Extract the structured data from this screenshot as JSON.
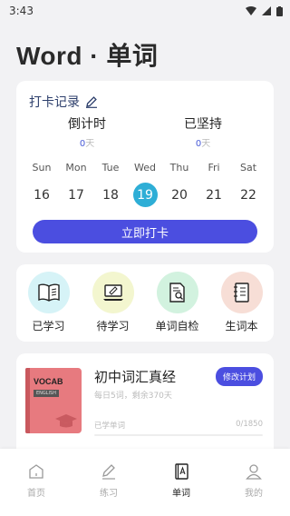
{
  "status": {
    "time": "3:43"
  },
  "title": "Word · 单词",
  "checkin": {
    "header": "打卡记录",
    "countdown_label": "倒计时",
    "countdown_value": "0",
    "countdown_unit": "天",
    "persist_label": "已坚持",
    "persist_value": "0",
    "persist_unit": "天",
    "week": [
      {
        "name": "Sun",
        "num": "16",
        "active": false
      },
      {
        "name": "Mon",
        "num": "17",
        "active": false
      },
      {
        "name": "Tue",
        "num": "18",
        "active": false
      },
      {
        "name": "Wed",
        "num": "19",
        "active": true
      },
      {
        "name": "Thu",
        "num": "20",
        "active": false
      },
      {
        "name": "Fri",
        "num": "21",
        "active": false
      },
      {
        "name": "Sat",
        "num": "22",
        "active": false
      }
    ],
    "button": "立即打卡"
  },
  "features": [
    {
      "label": "已学习",
      "icon": "open-book-icon",
      "bg": "#d6f3f7"
    },
    {
      "label": "待学习",
      "icon": "laptop-icon",
      "bg": "#f3f6cf"
    },
    {
      "label": "单词自检",
      "icon": "document-search-icon",
      "bg": "#d2f2df"
    },
    {
      "label": "生词本",
      "icon": "notebook-icon",
      "bg": "#f7ded6"
    }
  ],
  "plan": {
    "book_cover_text": "VOCAB",
    "book_tag": "ENGLISH",
    "title": "初中词汇真经",
    "subtitle": "每日5词，剩余370天",
    "edit_button": "修改计划",
    "progress_label": "已学单词",
    "progress_value": "0/1850",
    "progress_fraction": 0
  },
  "tabs": [
    {
      "label": "首页",
      "icon": "home-icon",
      "active": false
    },
    {
      "label": "练习",
      "icon": "pencil-icon",
      "active": false
    },
    {
      "label": "单词",
      "icon": "word-book-icon",
      "active": true
    },
    {
      "label": "我的",
      "icon": "profile-icon",
      "active": false
    }
  ],
  "colors": {
    "accent": "#4b4ee0",
    "today": "#2eaed6",
    "header_text": "#2c3e6b"
  }
}
